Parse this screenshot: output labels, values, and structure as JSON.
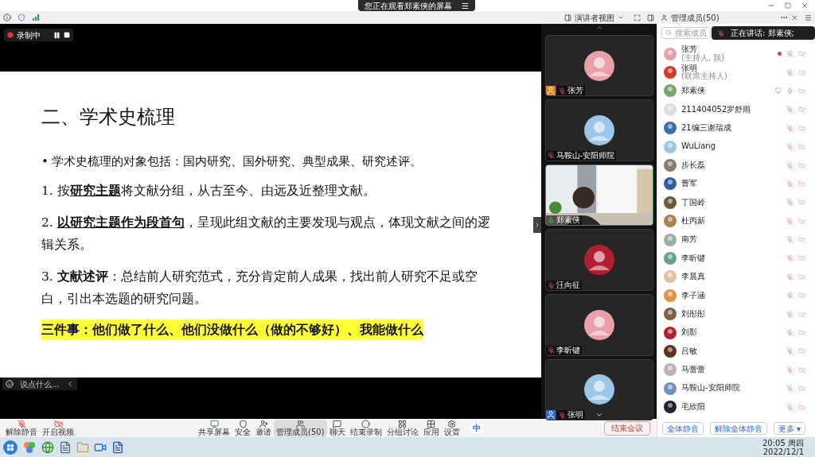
{
  "banner": {
    "text": "您正在观看郑素侠的屏幕",
    "menu": "☰"
  },
  "toolbar": {
    "view": "演讲者视图",
    "panel_title": "管理成员(50)"
  },
  "recording": {
    "label": "录制中",
    "on": true
  },
  "slide": {
    "title": "二、学术史梳理",
    "lines": [
      {
        "kind": "bullet",
        "marker": "•",
        "text": "学术史梳理的对象包括：国内研究、国外研究、典型成果、研究述评。"
      },
      {
        "kind": "plain",
        "text": "1. 按**研究主题**将文献分组，从古至今、由远及近整理文献。",
        "underline": true
      },
      {
        "kind": "plain",
        "text": "2. **以研究主题作为段首句**，呈现此组文献的主要发现与观点，体现文献之间的逻辑关系。",
        "underline": true
      },
      {
        "kind": "plain",
        "text": "3. **文献述评**：总结前人研究范式，充分肯定前人成果，找出前人研究不足或空白，引出本选题的研究问题。",
        "underline": false
      },
      {
        "kind": "highlight",
        "text": "三件事：他们做了什么、他们没做什么（做的不够好）、我能做什么",
        "underline": false
      }
    ]
  },
  "chat": {
    "placeholder": "说点什么..."
  },
  "videos": [
    {
      "name": "张芳",
      "kind": "avatar",
      "host": true,
      "speaking": false
    },
    {
      "name": "马鞍山-安阳师院",
      "kind": "avatar",
      "host": false,
      "speaking": false
    },
    {
      "name": "郑素侠",
      "kind": "camera",
      "host": false,
      "speaking": true
    },
    {
      "name": "汪向征",
      "kind": "avatar",
      "host": false,
      "speaking": false
    },
    {
      "name": "李昕键",
      "kind": "avatar",
      "host": false,
      "speaking": false
    },
    {
      "name": "张明",
      "kind": "avatar",
      "host": true,
      "speaking": false
    }
  ],
  "members": {
    "search_placeholder": "搜索成员",
    "speaking": "正在讲话: 郑素侠;",
    "list": [
      {
        "name": "张芳",
        "role": "(主持人, 我)",
        "muted": true,
        "sharing": false,
        "recording": true
      },
      {
        "name": "张明",
        "role": "(联席主持人)",
        "muted": true,
        "sharing": false,
        "recording": false
      },
      {
        "name": "郑素侠",
        "muted": false,
        "sharing": true,
        "recording": false
      },
      {
        "name": "211404052罗舒雨",
        "muted": true,
        "sharing": false,
        "recording": false
      },
      {
        "name": "21编三谢瑞成",
        "muted": true,
        "sharing": false,
        "recording": false
      },
      {
        "name": "WuLiang",
        "muted": true,
        "sharing": false,
        "recording": false
      },
      {
        "name": "步长磊",
        "muted": true,
        "sharing": false,
        "recording": false
      },
      {
        "name": "曹军",
        "muted": true,
        "sharing": false,
        "recording": false
      },
      {
        "name": "丁国岭",
        "muted": true,
        "sharing": false,
        "recording": false
      },
      {
        "name": "杜丙新",
        "muted": true,
        "sharing": false,
        "recording": false
      },
      {
        "name": "南芳",
        "muted": true,
        "sharing": false,
        "recording": false
      },
      {
        "name": "李昕键",
        "muted": true,
        "sharing": false,
        "recording": false
      },
      {
        "name": "李晨真",
        "muted": true,
        "sharing": false,
        "recording": false
      },
      {
        "name": "李子涵",
        "muted": true,
        "sharing": false,
        "recording": false
      },
      {
        "name": "刘彤彤",
        "muted": true,
        "sharing": false,
        "recording": false
      },
      {
        "name": "刘影",
        "muted": true,
        "sharing": false,
        "recording": false
      },
      {
        "name": "吕敏",
        "muted": true,
        "sharing": false,
        "recording": false
      },
      {
        "name": "马蕾蕾",
        "muted": true,
        "sharing": false,
        "recording": false
      },
      {
        "name": "马鞍山-安阳师院",
        "muted": true,
        "sharing": false,
        "recording": false
      },
      {
        "name": "毛欣阳",
        "muted": true,
        "sharing": false,
        "recording": false
      }
    ],
    "buttons": [
      "全体静音",
      "解除全体静音",
      "更多 ▾"
    ]
  },
  "controls": [
    {
      "label": "解除静音",
      "kind": "mic",
      "selected": false
    },
    {
      "label": "开启视频",
      "kind": "video",
      "selected": false
    },
    {
      "label": "共享屏幕",
      "kind": "share",
      "selected": false
    },
    {
      "label": "安全",
      "kind": "shield",
      "selected": false
    },
    {
      "label": "邀请",
      "kind": "invite",
      "selected": false
    },
    {
      "label": "管理成员(50)",
      "kind": "members",
      "selected": true
    },
    {
      "label": "聊天",
      "kind": "chat",
      "selected": false
    },
    {
      "label": "结束录制",
      "kind": "record",
      "selected": false
    },
    {
      "label": "分组讨论",
      "kind": "breakout",
      "selected": false
    },
    {
      "label": "应用",
      "kind": "apps",
      "selected": false
    },
    {
      "label": "设置",
      "kind": "settings",
      "selected": false
    }
  ],
  "end_button": "结束会议",
  "ime": "中",
  "clock": {
    "time": "20:05 周四",
    "date": "2022/12/1"
  }
}
